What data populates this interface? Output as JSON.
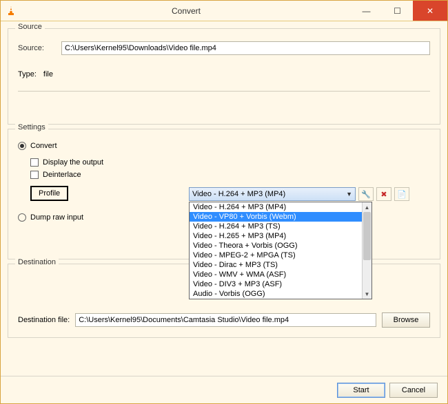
{
  "titlebar": {
    "title": "Convert",
    "minimize_icon": "—",
    "maximize_icon": "☐",
    "close_icon": "✕"
  },
  "source": {
    "legend": "Source",
    "label": "Source:",
    "value": "C:\\Users\\Kernel95\\Downloads\\Video file.mp4",
    "type_label": "Type:",
    "type_value": "file"
  },
  "settings": {
    "legend": "Settings",
    "convert_label": "Convert",
    "display_output_label": "Display the output",
    "deinterlace_label": "Deinterlace",
    "profile_button": "Profile",
    "profile_selected": "Video - H.264 + MP3 (MP4)",
    "options": [
      "Video - H.264 + MP3 (MP4)",
      "Video - VP80 + Vorbis (Webm)",
      "Video - H.264 + MP3 (TS)",
      "Video - H.265 + MP3 (MP4)",
      "Video - Theora + Vorbis (OGG)",
      "Video - MPEG-2 + MPGA (TS)",
      "Video - Dirac + MP3 (TS)",
      "Video - WMV + WMA (ASF)",
      "Video - DIV3 + MP3 (ASF)",
      "Audio - Vorbis (OGG)"
    ],
    "selected_index": 1,
    "tool_icon": "🔧",
    "delete_icon": "✖",
    "new_icon": "📄",
    "dump_raw_label": "Dump raw input"
  },
  "destination": {
    "legend": "Destination",
    "label": "Destination file:",
    "value": "C:\\Users\\Kernel95\\Documents\\Camtasia Studio\\Video file.mp4",
    "browse_label": "Browse"
  },
  "footer": {
    "start_label": "Start",
    "cancel_label": "Cancel"
  }
}
